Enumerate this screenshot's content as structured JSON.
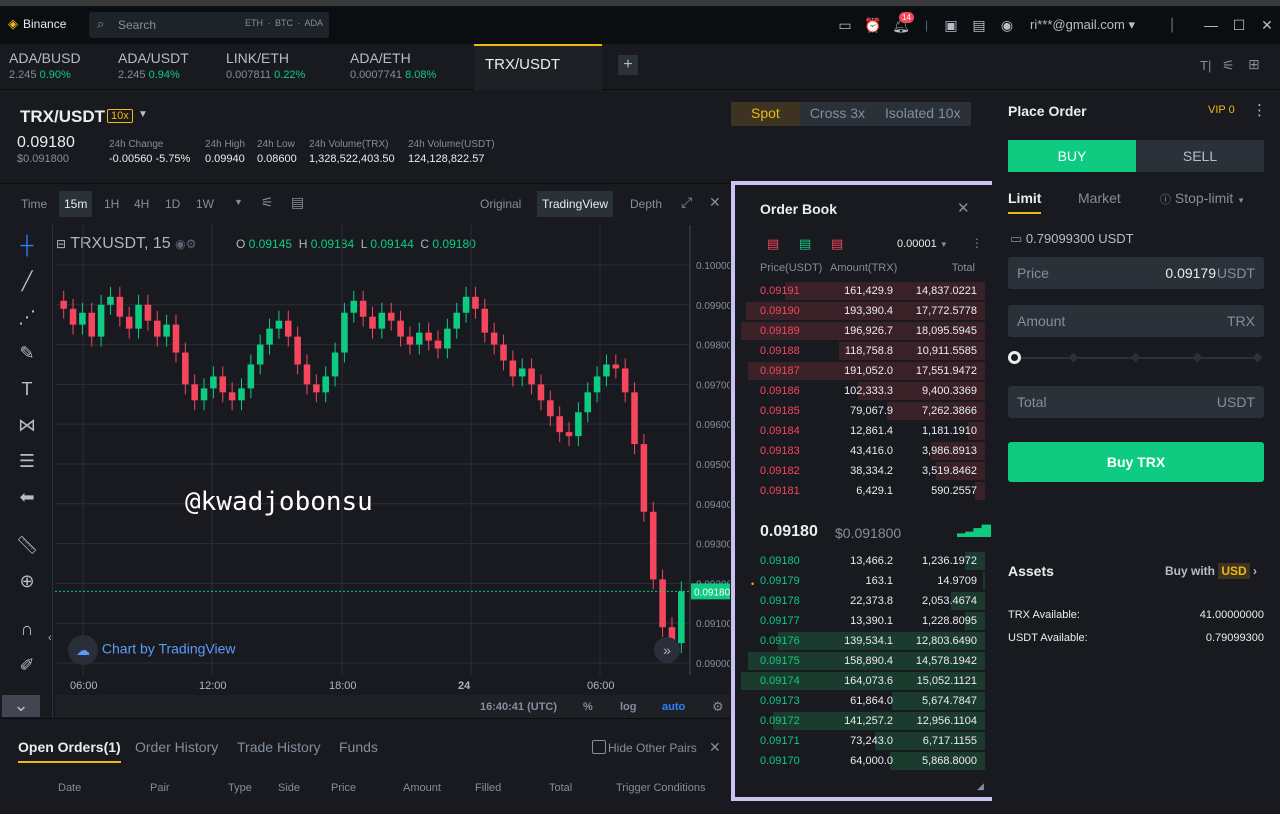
{
  "app": {
    "brand": "Binance",
    "search_placeholder": "Search",
    "search_chips": "ETH · BTC · ADA",
    "notif_count": "14",
    "account": "ri***@gmail.com"
  },
  "tabs": [
    {
      "name": "ADA/BUSD",
      "price": "2.245",
      "change": "0.90%"
    },
    {
      "name": "ADA/USDT",
      "price": "2.245",
      "change": "0.94%"
    },
    {
      "name": "LINK/ETH",
      "price": "0.007811",
      "change": "0.22%"
    },
    {
      "name": "ADA/ETH",
      "price": "0.0007741",
      "change": "8.08%"
    },
    {
      "name": "TRX/USDT"
    }
  ],
  "ticker": {
    "pair": "TRX/USDT",
    "leverage": "10x",
    "last": "0.09180",
    "last_usd": "$0.091800",
    "change_label": "24h Change",
    "change": "-0.00560 -5.75%",
    "high_label": "24h High",
    "high": "0.09940",
    "low_label": "24h Low",
    "low": "0.08600",
    "vol_trx_label": "24h Volume(TRX)",
    "vol_trx": "1,328,522,403.50",
    "vol_usdt_label": "24h Volume(USDT)",
    "vol_usdt": "124,128,822.57"
  },
  "modes": {
    "spot": "Spot",
    "cross": "Cross 3x",
    "isolated": "Isolated 10x"
  },
  "chart_tools": {
    "time": "Time",
    "intervals": [
      "15m",
      "1H",
      "4H",
      "1D",
      "1W"
    ],
    "original": "Original",
    "tradingview": "TradingView",
    "depth": "Depth"
  },
  "chart": {
    "symbol": "TRXUSDT, 15",
    "o": "0.09145",
    "h": "0.09184",
    "l": "0.09144",
    "c": "0.09180",
    "watermark": "@kwadjobonsu",
    "credit": "Chart by TradingView",
    "time": "16:40:41 (UTC)",
    "pct": "%",
    "log": "log",
    "auto": "auto",
    "price_tag": "0.09180"
  },
  "chart_data": {
    "type": "line",
    "x": [
      "06:00",
      "12:00",
      "18:00",
      "24",
      "06:00"
    ],
    "y_ticks": [
      "0.10000",
      "0.09900",
      "0.09800",
      "0.09700",
      "0.09600",
      "0.09500",
      "0.09400",
      "0.09300",
      "0.09200",
      "0.09100",
      "0.09000"
    ],
    "ylim": [
      0.0899,
      0.1002
    ],
    "close": [
      0.0989,
      0.0985,
      0.0988,
      0.0982,
      0.099,
      0.0992,
      0.0987,
      0.0984,
      0.099,
      0.0986,
      0.0982,
      0.0985,
      0.0978,
      0.097,
      0.0966,
      0.0969,
      0.0972,
      0.0968,
      0.0966,
      0.0969,
      0.0975,
      0.098,
      0.0984,
      0.0986,
      0.0982,
      0.0975,
      0.097,
      0.0968,
      0.0972,
      0.0978,
      0.0988,
      0.0991,
      0.0987,
      0.0984,
      0.0988,
      0.0986,
      0.0982,
      0.098,
      0.0983,
      0.0981,
      0.0979,
      0.0984,
      0.0988,
      0.0992,
      0.0989,
      0.0983,
      0.098,
      0.0976,
      0.0972,
      0.0974,
      0.097,
      0.0966,
      0.0962,
      0.0958,
      0.0957,
      0.0963,
      0.0968,
      0.0972,
      0.0975,
      0.0974,
      0.0968,
      0.0955,
      0.0938,
      0.0921,
      0.0909,
      0.0905,
      0.0918
    ]
  },
  "orders": {
    "tabs": [
      "Open Orders(1)",
      "Order History",
      "Trade History",
      "Funds"
    ],
    "hide_other": "Hide Other Pairs",
    "columns": [
      "Date",
      "Pair",
      "Type",
      "Side",
      "Price",
      "Amount",
      "Filled",
      "Total",
      "Trigger Conditions"
    ]
  },
  "orderbook": {
    "title": "Order Book",
    "precision": "0.00001",
    "col_price": "Price(USDT)",
    "col_amount": "Amount(TRX)",
    "col_total": "Total",
    "asks": [
      [
        "0.09191",
        "161,429.9",
        "14,837.0221"
      ],
      [
        "0.09190",
        "193,390.4",
        "17,772.5778"
      ],
      [
        "0.09189",
        "196,926.7",
        "18,095.5945"
      ],
      [
        "0.09188",
        "118,758.8",
        "10,911.5585"
      ],
      [
        "0.09187",
        "191,052.0",
        "17,551.9472"
      ],
      [
        "0.09186",
        "102,333.3",
        "9,400.3369"
      ],
      [
        "0.09185",
        "79,067.9",
        "7,262.3866"
      ],
      [
        "0.09184",
        "12,861.4",
        "1,181.1910"
      ],
      [
        "0.09183",
        "43,416.0",
        "3,986.8913"
      ],
      [
        "0.09182",
        "38,334.2",
        "3,519.8462"
      ],
      [
        "0.09181",
        "6,429.1",
        "590.2557"
      ]
    ],
    "ask_depth": [
      0.82,
      0.98,
      1.0,
      0.6,
      0.97,
      0.52,
      0.4,
      0.07,
      0.22,
      0.2,
      0.04
    ],
    "mid": "0.09180",
    "mid_usd": "$0.091800",
    "bids": [
      [
        "0.09180",
        "13,466.2",
        "1,236.1972"
      ],
      [
        "0.09179",
        "163.1",
        "14.9709"
      ],
      [
        "0.09178",
        "22,373.8",
        "2,053.4674"
      ],
      [
        "0.09177",
        "13,390.1",
        "1,228.8095"
      ],
      [
        "0.09176",
        "139,534.1",
        "12,803.6490"
      ],
      [
        "0.09175",
        "158,890.4",
        "14,578.1942"
      ],
      [
        "0.09174",
        "164,073.6",
        "15,052.1121"
      ],
      [
        "0.09173",
        "61,864.0",
        "5,674.7847"
      ],
      [
        "0.09172",
        "141,257.2",
        "12,956.1104"
      ],
      [
        "0.09171",
        "73,243.0",
        "6,717.1155"
      ],
      [
        "0.09170",
        "64,000.0",
        "5,868.8000"
      ]
    ],
    "bid_depth": [
      0.08,
      0.01,
      0.14,
      0.08,
      0.85,
      0.97,
      1.0,
      0.38,
      0.87,
      0.45,
      0.39
    ]
  },
  "place_order": {
    "title": "Place Order",
    "vip": "VIP 0",
    "buy": "BUY",
    "sell": "SELL",
    "limit": "Limit",
    "market": "Market",
    "stop_limit": "Stop-limit",
    "balance": "0.79099300 USDT",
    "price_label": "Price",
    "price_value": "0.09179",
    "price_unit": "USDT",
    "amount_label": "Amount",
    "amount_unit": "TRX",
    "total_label": "Total",
    "total_unit": "USDT",
    "buy_btn": "Buy TRX"
  },
  "assets": {
    "title": "Assets",
    "buy_with": "Buy with",
    "currency": "USD",
    "trx_label": "TRX Available:",
    "trx_value": "41.00000000",
    "usdt_label": "USDT Available:",
    "usdt_value": "0.79099300"
  },
  "colors": {
    "up": "#0ecb81",
    "down": "#f6465d",
    "accent": "#f0b90b",
    "highlight": "#c9c2f2"
  }
}
